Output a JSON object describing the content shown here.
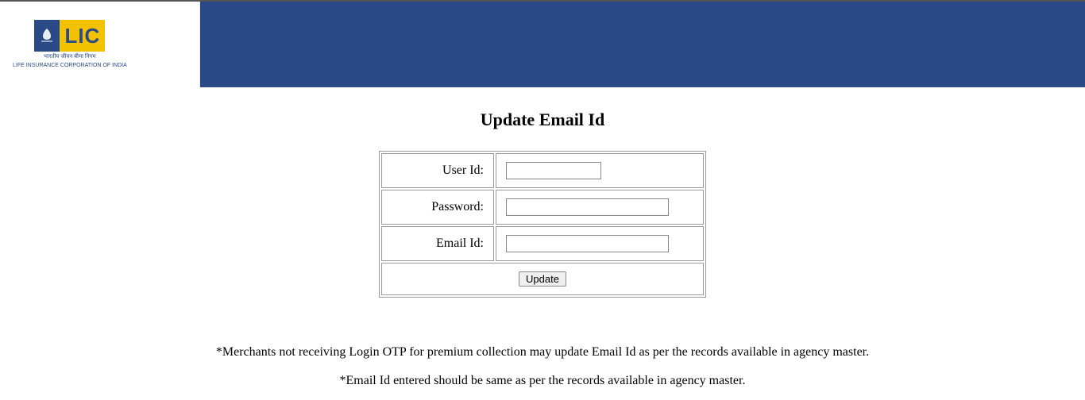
{
  "logo": {
    "brand": "LIC",
    "subtitle1": "भारतीय जीवन बीमा निगम",
    "subtitle2": "LIFE INSURANCE CORPORATION OF INDIA"
  },
  "page": {
    "title": "Update Email Id"
  },
  "form": {
    "userIdLabel": "User Id:",
    "passwordLabel": "Password:",
    "emailLabel": "Email Id:",
    "updateButton": "Update",
    "userIdValue": "",
    "passwordValue": "",
    "emailValue": ""
  },
  "notes": {
    "line1": "*Merchants not receiving Login OTP for premium collection may update Email Id as per the records available in agency master.",
    "line2": "*Email Id entered should be same as per the records available in agency master."
  }
}
